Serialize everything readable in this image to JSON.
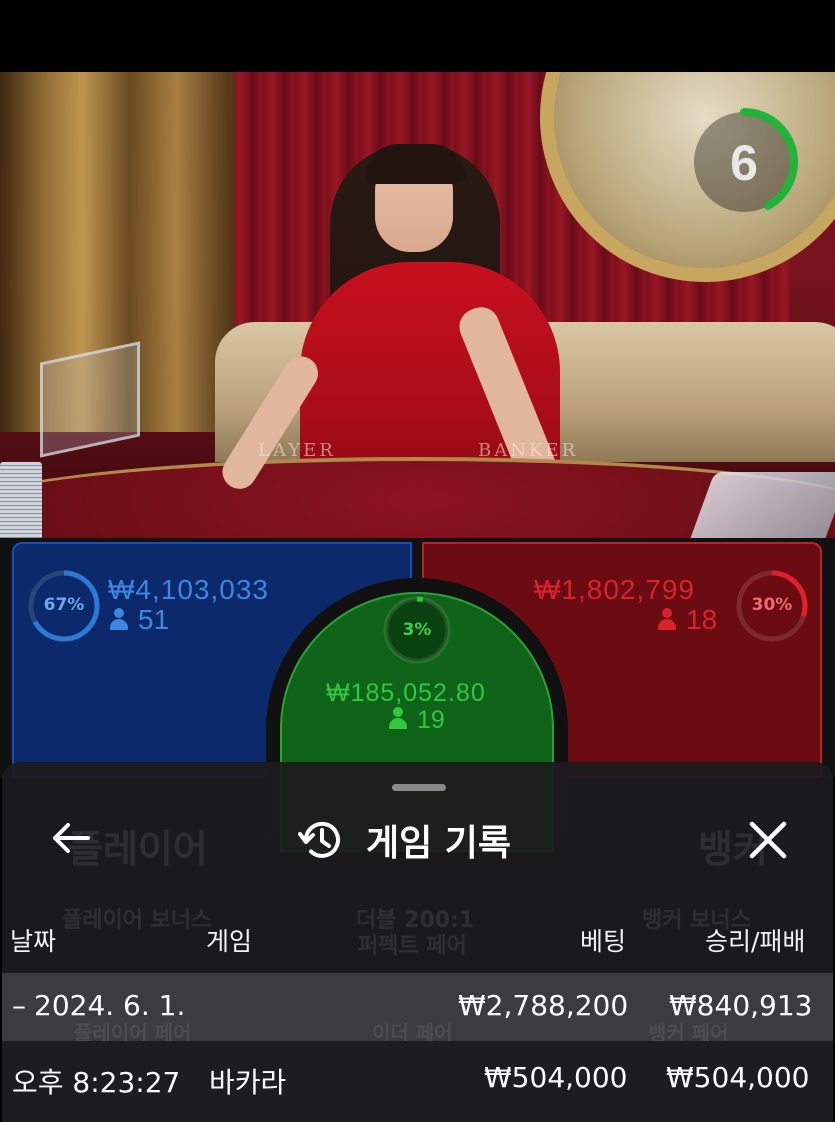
{
  "timer": {
    "value": "6",
    "remaining_fraction": 0.42,
    "color": "#22b43a"
  },
  "table_labels": {
    "player": "LAYER",
    "banker": "BANKER"
  },
  "bets": {
    "player": {
      "percent": "67%",
      "percent_value": 0.67,
      "amount": "₩4,103,033",
      "players": "51",
      "color": "#2a7ad6"
    },
    "tie": {
      "percent": "3%",
      "percent_value": 0.03,
      "amount": "₩185,052.80",
      "players": "19",
      "color": "#2ec43c"
    },
    "banker": {
      "percent": "30%",
      "percent_value": 0.3,
      "amount": "₩1,802,799",
      "players": "18",
      "color": "#e0202a"
    }
  },
  "history": {
    "title": "게임 기록",
    "back_icon": "arrow-left-icon",
    "history_icon": "history-clock-icon",
    "close_icon": "close-icon",
    "columns": {
      "date": "날짜",
      "game": "게임",
      "bet": "베팅",
      "result": "승리/패배"
    },
    "date_row": {
      "date": "2024. 6. 1.",
      "bet": "₩2,788,200",
      "result": "₩840,913"
    },
    "game_row": {
      "time": "오후 8:23:27",
      "game": "바카라",
      "bet": "₩504,000",
      "result": "₩504,000"
    },
    "background_text": {
      "player_tab": "플레이어",
      "banker_tab": "뱅커",
      "player_bonus": "플레이어 보너스",
      "perfect_pair_line1": "더블 200:1",
      "perfect_pair_line2": "퍼펙트 페어",
      "banker_bonus": "뱅커 보너스",
      "player_pair": "플레이어 페어",
      "either_pair": "이더 페어",
      "banker_pair": "뱅커 페어"
    }
  }
}
